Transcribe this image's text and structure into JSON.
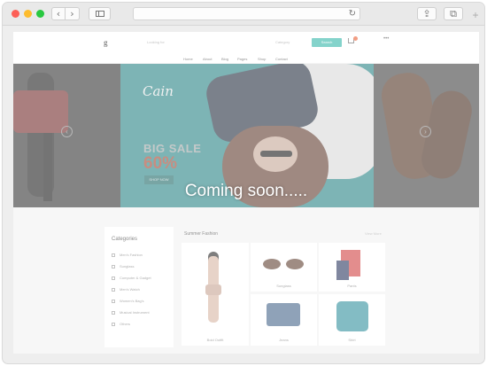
{
  "browser": {
    "back": "‹",
    "forward": "›",
    "reload": "↻",
    "share": "⇪",
    "tabs": "⧉",
    "new_tab": "+"
  },
  "site": {
    "logo": "g",
    "search_placeholder": "Looking for",
    "category": "Category",
    "search_button": "Search",
    "nav": [
      "Home",
      "About",
      "Blog",
      "Pages",
      "Shop",
      "Contact"
    ]
  },
  "banner": {
    "script_logo": "Cain",
    "big_sale": "BIG SALE",
    "percent": "60%",
    "shop_now": "SHOP NOW"
  },
  "sidebar": {
    "title": "Categories",
    "items": [
      "Men's Fashion",
      "Sunglass",
      "Computer & Gadget",
      "Men's Watch",
      "Women's Bag's",
      "Musical Instrument",
      "Others"
    ]
  },
  "featured": {
    "title": "Summer Fashion",
    "view_more": "View More",
    "products": [
      "Bold Outfit",
      "Sunglass",
      "Pants",
      "Jeans",
      "Shirt"
    ]
  },
  "overlay_text": "Coming soon.....",
  "colors": {
    "accent": "#2cb3a5",
    "sale": "#e8562a"
  }
}
